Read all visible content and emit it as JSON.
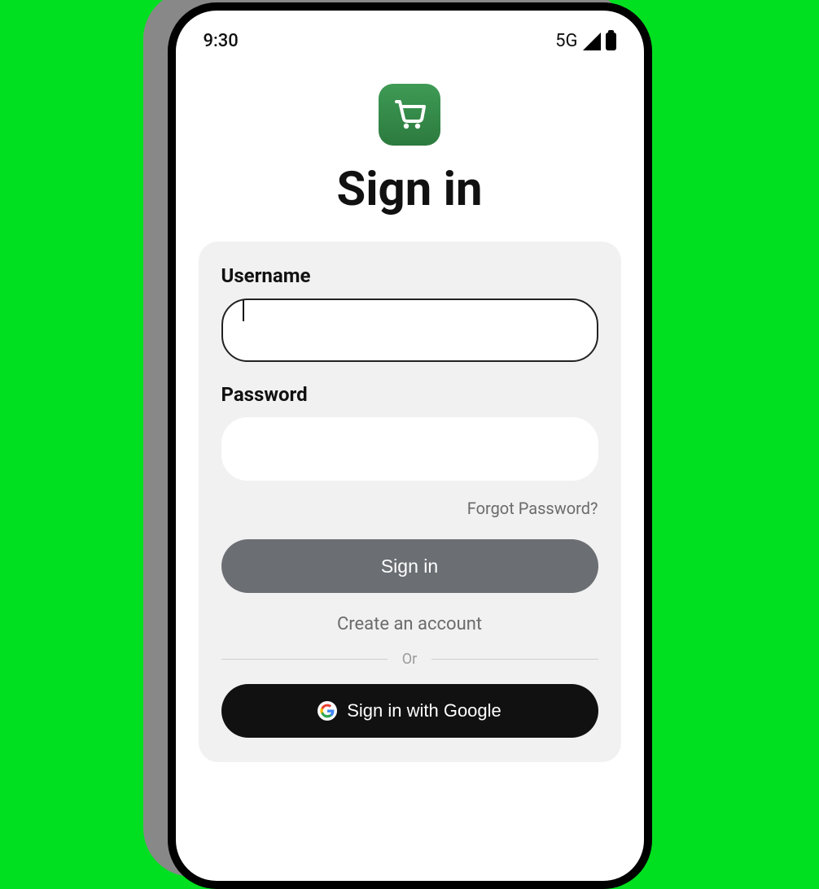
{
  "status_bar": {
    "time": "9:30",
    "network_kind": "5G"
  },
  "header": {
    "title": "Sign in",
    "logo_icon": "shopping-cart"
  },
  "form": {
    "username": {
      "label": "Username",
      "value": ""
    },
    "password": {
      "label": "Password",
      "value": ""
    },
    "forgot_link": "Forgot Password?",
    "submit_label": "Sign in",
    "create_account_label": "Create an account",
    "divider_label": "Or",
    "google_button_label": "Sign in with Google"
  },
  "colors": {
    "background_outer": "#00e020",
    "card_bg": "#f1f1f1",
    "primary_btn": "#6b6f73",
    "google_btn": "#111111",
    "logo_bg_top": "#3e9b55",
    "logo_bg_bottom": "#2c7a3e"
  }
}
